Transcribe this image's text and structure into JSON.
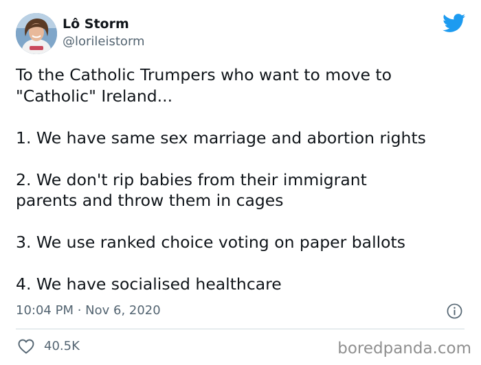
{
  "author": {
    "display_name": "Lô Storm",
    "handle": "@lorileistorm",
    "avatar_icon": "profile-photo"
  },
  "tweet": {
    "paragraphs": [
      "To the Catholic Trumpers who want to move to \"Catholic\" Ireland...",
      "1. We have same sex marriage and abortion rights",
      "2. We don't rip babies from their immigrant parents and throw them in cages",
      "3. We use ranked choice voting on paper ballots",
      "4. We have socialised healthcare"
    ],
    "timestamp": "10:04 PM · Nov 6, 2020"
  },
  "engagement": {
    "likes": "40.5K",
    "like_icon": "heart-outline-icon"
  },
  "icons": {
    "brand": "twitter-bird-icon",
    "info": "info-icon"
  },
  "watermark": "boredpanda.com",
  "colors": {
    "twitter_blue": "#1d9bf0",
    "text_primary": "#0f1419",
    "text_secondary": "#536471",
    "divider": "#cfd9de"
  }
}
